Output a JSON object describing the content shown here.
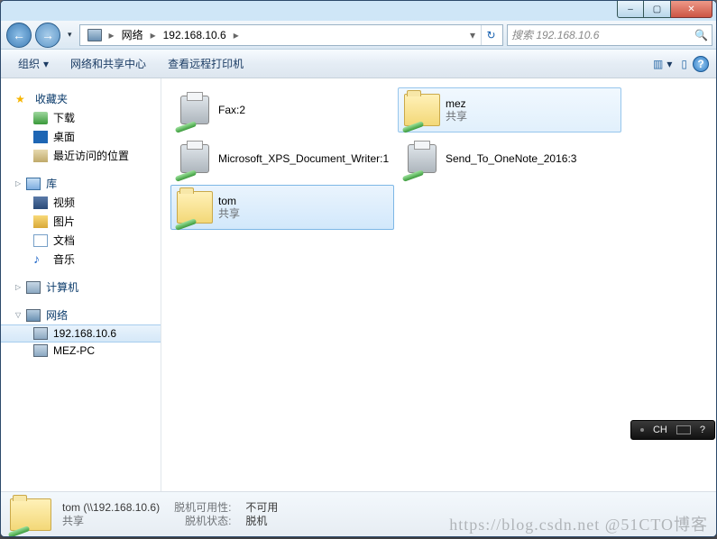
{
  "caption": {
    "min": "–",
    "max": "▢",
    "close": "✕"
  },
  "nav": {
    "back": "←",
    "forward": "→",
    "history_dropdown": "▾",
    "breadcrumbs": [
      "网络",
      "192.168.10.6"
    ],
    "refresh_icon": "↻"
  },
  "search": {
    "placeholder": "搜索 192.168.10.6",
    "icon": "🔍"
  },
  "toolbar": {
    "organize": "组织",
    "net_center": "网络和共享中心",
    "remote_printers": "查看远程打印机",
    "view_icon": "▥",
    "view_drop": "▾",
    "preview_icon": "▯",
    "help": "?"
  },
  "sidebar": {
    "favorites": {
      "label": "收藏夹",
      "items": [
        {
          "label": "下载"
        },
        {
          "label": "桌面"
        },
        {
          "label": "最近访问的位置"
        }
      ]
    },
    "libraries": {
      "label": "库",
      "items": [
        {
          "label": "视频"
        },
        {
          "label": "图片"
        },
        {
          "label": "文档"
        },
        {
          "label": "音乐"
        }
      ]
    },
    "computer": {
      "label": "计算机"
    },
    "network": {
      "label": "网络",
      "items": [
        {
          "label": "192.168.10.6",
          "selected": true
        },
        {
          "label": "MEZ-PC"
        }
      ]
    }
  },
  "content": {
    "items": [
      {
        "type": "printer",
        "name": "Fax:2"
      },
      {
        "type": "folder",
        "name": "mez",
        "sub": "共享",
        "selected": "light"
      },
      {
        "type": "printer",
        "name": "Microsoft_XPS_Document_Writer:1"
      },
      {
        "type": "printer",
        "name": "Send_To_OneNote_2016:3"
      },
      {
        "type": "folder",
        "name": "tom",
        "sub": "共享",
        "selected": "strong"
      }
    ]
  },
  "details": {
    "name": "tom (\\\\192.168.10.6)",
    "sub": "共享",
    "offline_avail_k": "脱机可用性:",
    "offline_avail_v": "不可用",
    "offline_state_k": "脱机状态:",
    "offline_state_v": "脱机"
  },
  "ime": {
    "label": "CH"
  },
  "watermark": "https://blog.csdn.net  @51CTO博客"
}
